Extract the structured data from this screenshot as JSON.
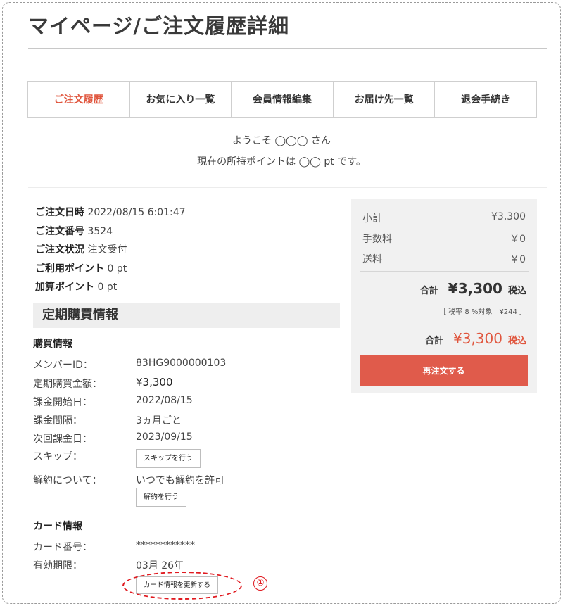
{
  "page": {
    "title": "マイページ/ご注文履歴詳細"
  },
  "tabs": [
    {
      "label": "ご注文履歴",
      "active": true
    },
    {
      "label": "お気に入り一覧"
    },
    {
      "label": "会員情報編集"
    },
    {
      "label": "お届け先一覧"
    },
    {
      "label": "退会手続き"
    }
  ],
  "welcome": {
    "line1": "ようこそ ◯◯◯ さん",
    "line2": "現在の所持ポイントは ◯◯ pt です。"
  },
  "order": {
    "date_label": "ご注文日時",
    "date_value": "2022/08/15 6:01:47",
    "number_label": "ご注文番号",
    "number_value": "3524",
    "status_label": "ご注文状況",
    "status_value": "注文受付",
    "used_points_label": "ご利用ポイント",
    "used_points_value": "0 pt",
    "added_points_label": "加算ポイント",
    "added_points_value": "0 pt"
  },
  "subscription": {
    "section_title": "定期購買情報",
    "purchase_heading": "購買情報",
    "member_id_label": "メンバーID：",
    "member_id_value": "83HG9000000103",
    "amount_label": "定期購買金額：",
    "amount_value": "¥3,300",
    "start_label": "課金開始日：",
    "start_value": "2022/08/15",
    "interval_label": "課金間隔：",
    "interval_value": "3ヵ月ごと",
    "next_label": "次回課金日：",
    "next_value": "2023/09/15",
    "skip_label": "スキップ：",
    "skip_button": "スキップを行う",
    "cancel_label": "解約について：",
    "cancel_value": "いつでも解約を許可",
    "cancel_button": "解約を行う",
    "card_heading": "カード情報",
    "card_number_label": "カード番号：",
    "card_number_value": "************",
    "expiry_label": "有効期限：",
    "expiry_value": "03月 26年",
    "card_update_button": "カード情報を更新する"
  },
  "summary": {
    "subtotal_label": "小計",
    "subtotal_value": "¥3,300",
    "fee_label": "手数料",
    "fee_value": "￥0",
    "shipping_label": "送料",
    "shipping_value": "￥0",
    "total_label": "合計",
    "total_value": "¥3,300",
    "tax_label": "税込",
    "tax_note": "［ 税率 8 %対象　¥244 ］",
    "grand_total_label": "合計",
    "grand_total_value": "¥3,300",
    "grand_tax_label": "税込",
    "reorder_button": "再注文する"
  },
  "annotation": {
    "marker": "①",
    "color": "#e0191f"
  },
  "colors": {
    "accent": "#e0563e",
    "button": "#e05b4b",
    "panel": "#f1f1f1"
  }
}
